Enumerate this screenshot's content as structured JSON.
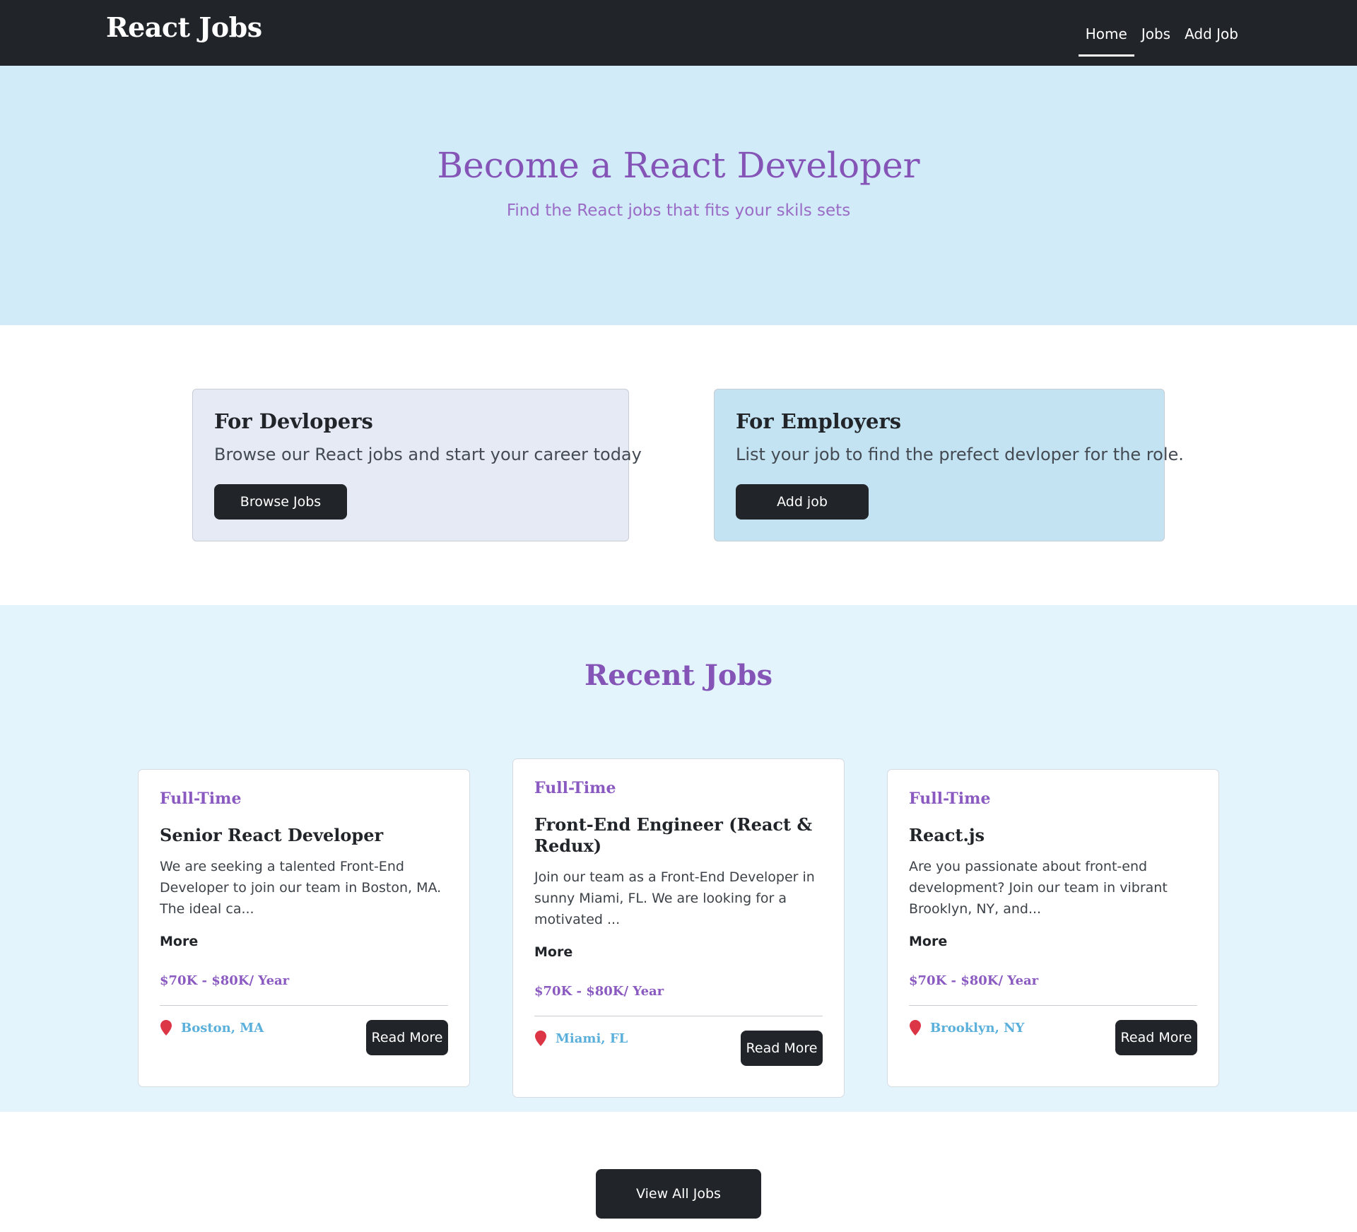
{
  "navbar": {
    "brand": "React Jobs",
    "links": [
      {
        "label": "Home",
        "active": true
      },
      {
        "label": "Jobs",
        "active": false
      },
      {
        "label": "Add Job",
        "active": false
      }
    ]
  },
  "hero": {
    "title": "Become a React Developer",
    "subtitle": "Find the React jobs that fits your skils sets"
  },
  "info_cards": {
    "developers": {
      "title": "For Devlopers",
      "text": "Browse our React jobs and start your career today",
      "button": "Browse Jobs"
    },
    "employers": {
      "title": "For Employers",
      "text": "List your job to find the prefect devloper for the role.",
      "button": "Add job"
    }
  },
  "recent_jobs": {
    "title": "Recent Jobs",
    "jobs": [
      {
        "type": "Full-Time",
        "title": "Senior React Developer",
        "description": "We are seeking a talented Front-End Developer to join our team in Boston, MA. The ideal ca...",
        "more": "More",
        "salary": "$70K - $80K/ Year",
        "location": "Boston, MA",
        "button": "Read More"
      },
      {
        "type": "Full-Time",
        "title": "Front-End Engineer (React & Redux)",
        "description": "Join our team as a Front-End Developer in sunny Miami, FL. We are looking for a motivated ...",
        "more": "More",
        "salary": "$70K - $80K/ Year",
        "location": "Miami, FL",
        "button": "Read More"
      },
      {
        "type": "Full-Time",
        "title": "React.js",
        "description": "Are you passionate about front-end development? Join our team in vibrant Brooklyn, NY, and...",
        "more": "More",
        "salary": "$70K - $80K/ Year",
        "location": "Brooklyn, NY",
        "button": "Read More"
      }
    ]
  },
  "view_all": {
    "label": "View All Jobs"
  },
  "colors": {
    "navbar": "#212529",
    "accent_purple": "#8554b7",
    "location_blue": "#5ab0db",
    "pin_red": "#dc3545"
  },
  "icons": {
    "location": "map-pin-icon"
  }
}
